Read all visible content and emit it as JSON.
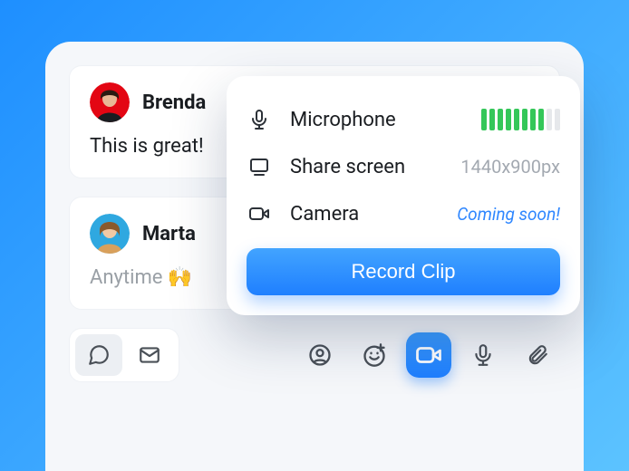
{
  "messages": [
    {
      "name": "Brenda",
      "body": "This is great!",
      "muted": false
    },
    {
      "name": "Marta",
      "body": "Anytime 🙌",
      "muted": true
    }
  ],
  "popover": {
    "mic_label": "Microphone",
    "mic_level": 8,
    "mic_level_max": 10,
    "screen_label": "Share screen",
    "screen_res": "1440x900px",
    "camera_label": "Camera",
    "camera_note": "Coming soon!",
    "record_label": "Record Clip"
  },
  "icons": {
    "chat": "chat-icon",
    "mail": "mail-icon",
    "mention": "mention-icon",
    "emoji_add": "emoji-add-icon",
    "video": "video-icon",
    "mic": "microphone-icon",
    "attach": "paperclip-icon",
    "screen": "screen-icon",
    "camera": "camera-icon"
  }
}
